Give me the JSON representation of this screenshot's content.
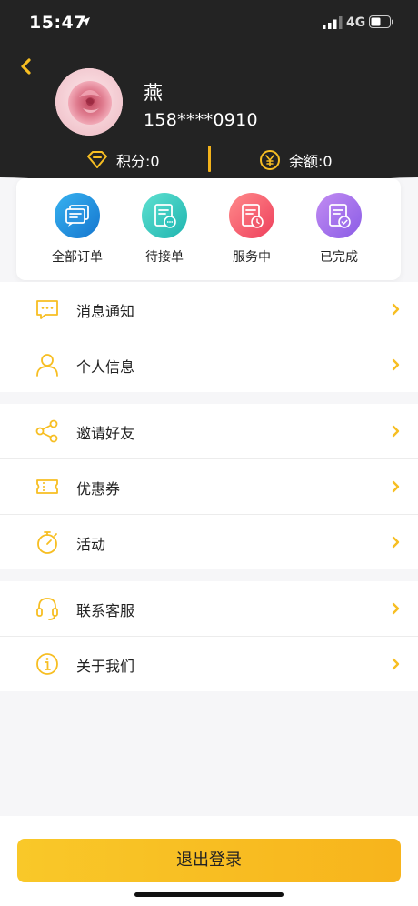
{
  "status_bar": {
    "time": "15:47",
    "network": "4G"
  },
  "profile": {
    "name": "燕",
    "phone": "158****0910"
  },
  "stats": {
    "points": "积分:0",
    "balance": "余额:0"
  },
  "orders": [
    {
      "label": "全部订单",
      "icon": "orders-list-icon",
      "color": "#1f8fe0"
    },
    {
      "label": "待接单",
      "icon": "pending-order-icon",
      "color": "#2bc8c0"
    },
    {
      "label": "服务中",
      "icon": "in-service-icon",
      "color": "#f2586a"
    },
    {
      "label": "已完成",
      "icon": "completed-icon",
      "color": "#9d6ef0"
    }
  ],
  "menu": {
    "group1": [
      {
        "label": "消息通知",
        "icon": "message-icon"
      },
      {
        "label": "个人信息",
        "icon": "user-icon"
      }
    ],
    "group2": [
      {
        "label": "邀请好友",
        "icon": "share-icon"
      },
      {
        "label": "优惠券",
        "icon": "coupon-icon"
      },
      {
        "label": "活动",
        "icon": "stopwatch-icon"
      }
    ],
    "group3": [
      {
        "label": "联系客服",
        "icon": "headset-icon"
      },
      {
        "label": "关于我们",
        "icon": "info-icon"
      }
    ]
  },
  "logout_label": "退出登录",
  "colors": {
    "accent": "#f7be22",
    "header_bg": "#232323"
  }
}
